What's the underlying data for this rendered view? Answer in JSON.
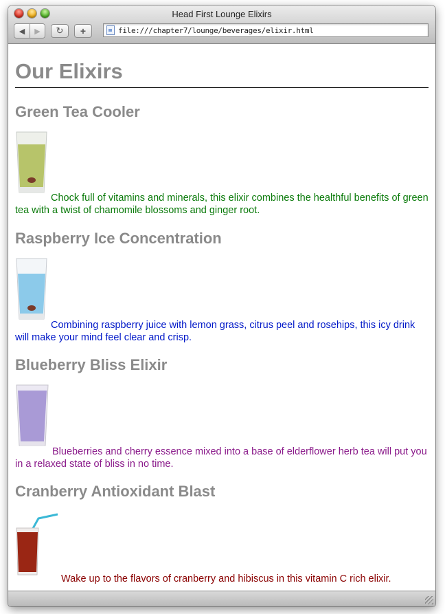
{
  "window": {
    "title": "Head First Lounge Elixirs"
  },
  "toolbar": {
    "back_icon": "back-arrow",
    "forward_icon": "forward-arrow",
    "reload_icon": "reload",
    "add_icon": "plus"
  },
  "address": {
    "url": "file:///chapter7/lounge/beverages/elixir.html"
  },
  "page": {
    "heading": "Our Elixirs",
    "elixirs": [
      {
        "name": "Green Tea Cooler",
        "description": "Chock full of vitamins and minerals, this elixir combines the healthful benefits of green tea with a twist of chamomile blossoms and ginger root.",
        "color": "#0a7a0a",
        "drink_color": "#b7c46a"
      },
      {
        "name": "Raspberry Ice Concentration",
        "description": "Combining raspberry juice with lemon grass, citrus peel and rosehips, this icy drink will make your mind feel clear and crisp.",
        "color": "#0018c8",
        "drink_color": "#8ccaea"
      },
      {
        "name": "Blueberry Bliss Elixir",
        "description": "Blueberries and cherry essence mixed into a base of elderflower herb tea will put you in a relaxed state of bliss in no time.",
        "color": "#8a1a8a",
        "drink_color": "#a99ad6"
      },
      {
        "name": "Cranberry Antioxidant Blast",
        "description": "Wake up to the flavors of cranberry and hibiscus in this vitamin C rich elixir.",
        "color": "#8a0000",
        "drink_color": "#9a2614"
      }
    ]
  }
}
